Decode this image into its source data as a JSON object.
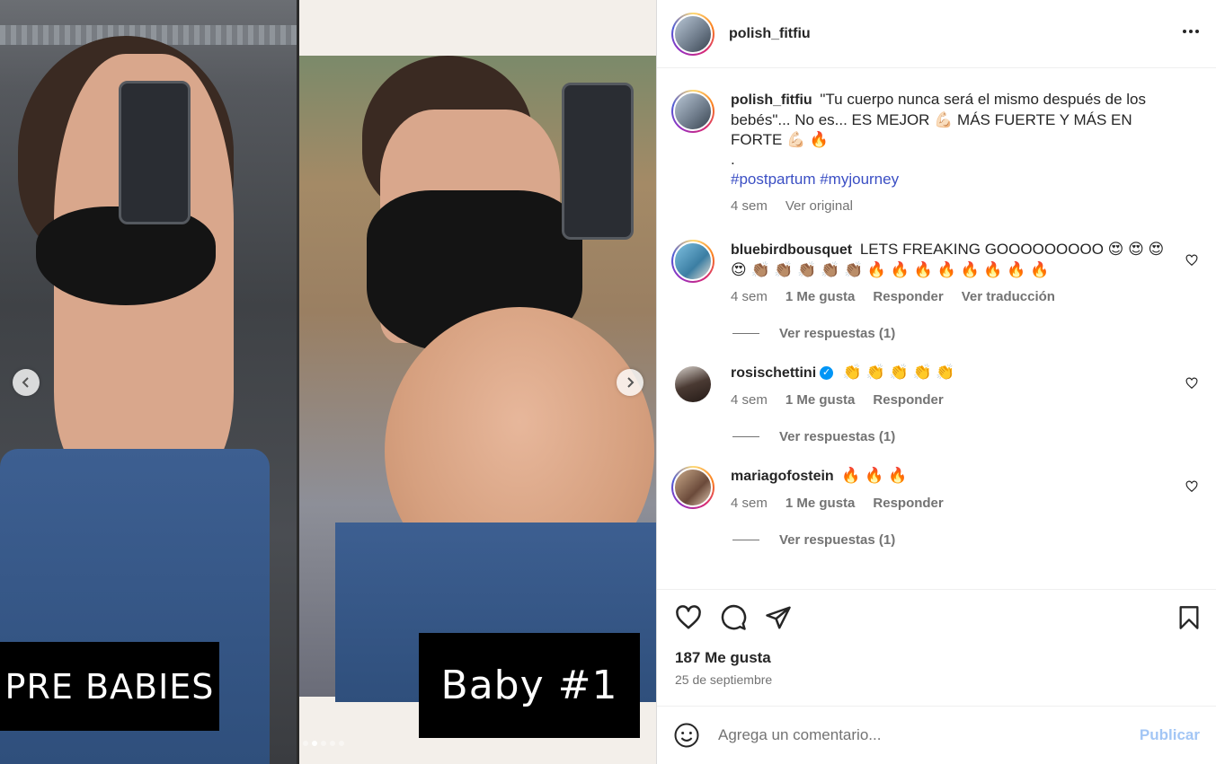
{
  "media": {
    "left_label": "PRE BABIES",
    "right_label": "Baby #1",
    "prev_icon": "chevron-left-icon",
    "next_icon": "chevron-right-icon",
    "dots_count": 5,
    "active_dot": 1
  },
  "header": {
    "username": "polish_fitfiu",
    "more_icon": "more-horizontal-icon"
  },
  "caption": {
    "username": "polish_fitfiu",
    "text_line": "\"Tu cuerpo nunca será el mismo después de los bebés\"... No es... ES MEJOR 💪🏻 MÁS FUERTE Y MÁS EN FORTE 💪🏻 🔥",
    "dot": ".",
    "hashtags": "#postpartum #myjourney",
    "time": "4 sem",
    "see_original": "Ver original"
  },
  "comments": [
    {
      "username": "bluebirdbousquet",
      "text": "LETS FREAKING GOOOOOOOOO 😍 😍 😍 😍 👏🏽 👏🏽 👏🏽 👏🏽 👏🏽 🔥 🔥 🔥 🔥 🔥 🔥 🔥 🔥",
      "time": "4 sem",
      "likes": "1 Me gusta",
      "reply": "Responder",
      "translate": "Ver traducción",
      "view_replies": "Ver respuestas (1)"
    },
    {
      "username": "rosischettini",
      "verified": true,
      "text": "👏 👏 👏 👏 👏",
      "time": "4 sem",
      "likes": "1 Me gusta",
      "reply": "Responder",
      "view_replies": "Ver respuestas (1)"
    },
    {
      "username": "mariagofostein",
      "text": "🔥 🔥 🔥",
      "time": "4 sem",
      "likes": "1 Me gusta",
      "reply": "Responder",
      "view_replies": "Ver respuestas (1)"
    }
  ],
  "actions": {
    "like_icon": "heart-icon",
    "comment_icon": "comment-icon",
    "share_icon": "send-icon",
    "save_icon": "bookmark-icon",
    "likes_count": "187 Me gusta",
    "date": "25 de septiembre"
  },
  "add_comment": {
    "emoji_icon": "smiley-icon",
    "placeholder": "Agrega un comentario...",
    "post_label": "Publicar"
  }
}
